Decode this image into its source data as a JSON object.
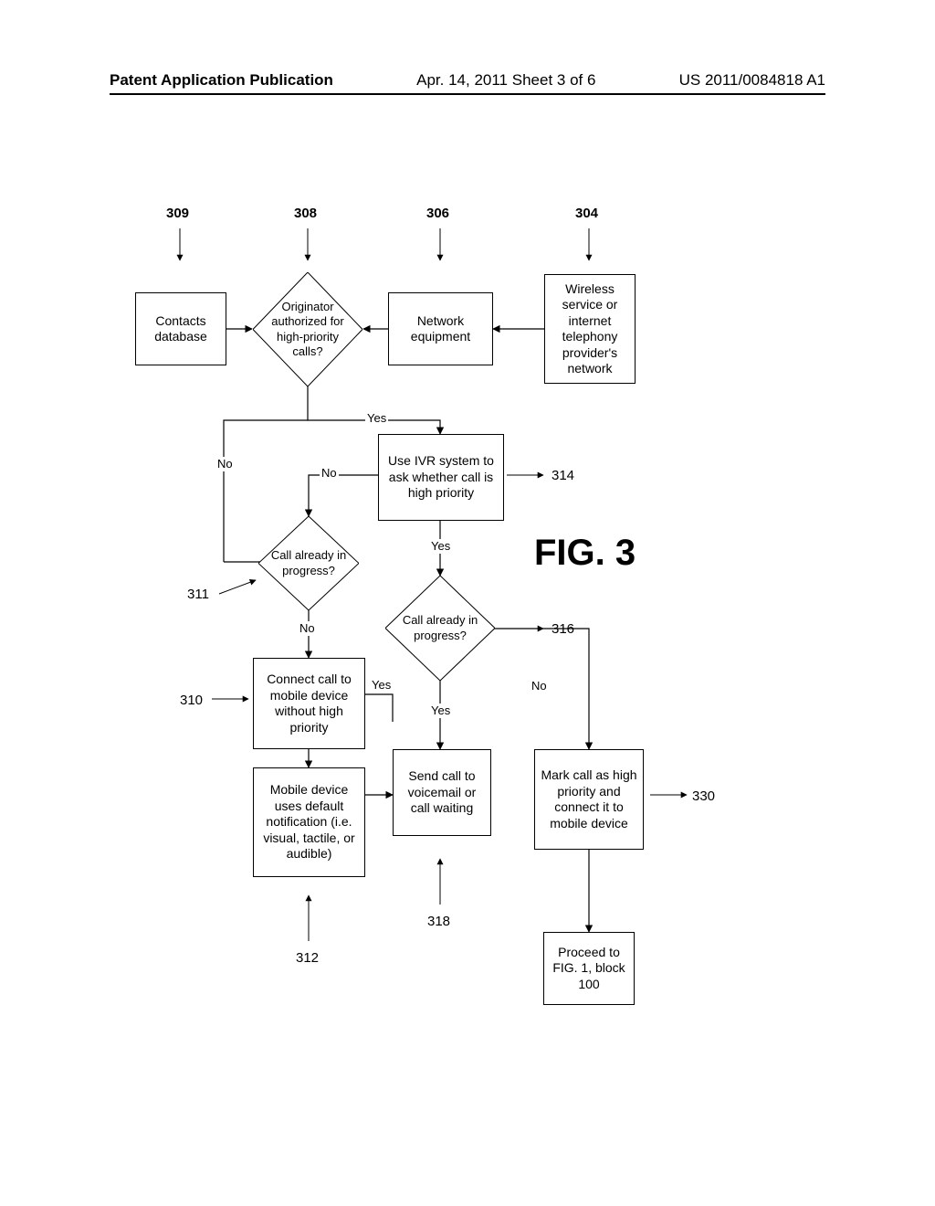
{
  "header": {
    "left": "Patent Application Publication",
    "center": "Apr. 14, 2011  Sheet 3 of 6",
    "right": "US 2011/0084818 A1"
  },
  "figure_title": "FIG. 3",
  "refs": {
    "r309": "309",
    "r308": "308",
    "r306": "306",
    "r304": "304",
    "r314": "314",
    "r311": "311",
    "r316": "316",
    "r310": "310",
    "r330": "330",
    "r318": "318",
    "r312": "312"
  },
  "nodes": {
    "contacts_db": "Contacts database",
    "originator": "Originator authorized for high-priority calls?",
    "network_equip": "Network equipment",
    "wireless": "Wireless service or internet telephony provider's network",
    "ivr": "Use IVR system to ask whether call is high priority",
    "call_prog_311": "Call already in progress?",
    "call_prog_316": "Call already in progress?",
    "connect_no_high": "Connect call to mobile device without high priority",
    "default_notif": "Mobile device uses default notification (i.e. visual, tactile, or audible)",
    "voicemail": "Send call to voicemail or call waiting",
    "mark_high": "Mark call as high priority and connect it to mobile device",
    "proceed": "Proceed to FIG. 1, block 100"
  },
  "edges": {
    "yes": "Yes",
    "no": "No"
  }
}
